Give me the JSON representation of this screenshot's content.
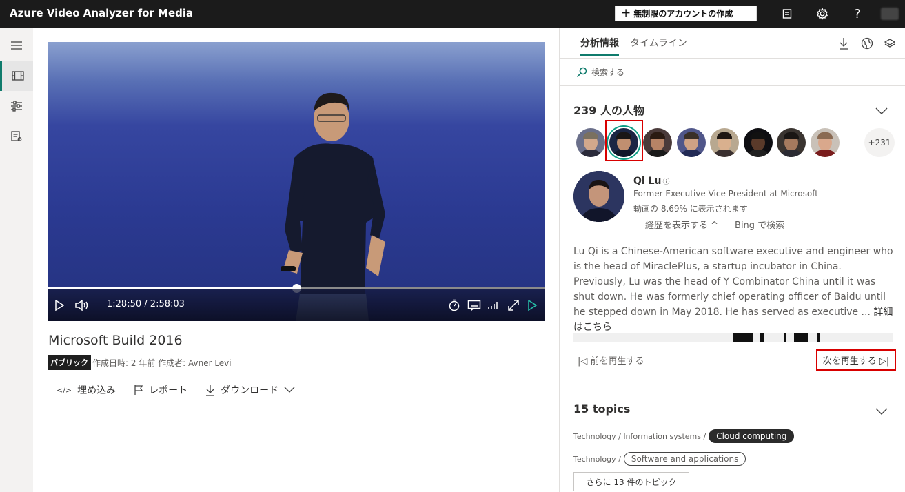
{
  "app": {
    "title": "Azure Video Analyzer for Media"
  },
  "header": {
    "create_account_label": "無制限のアカウントの作成",
    "icons": [
      "feedback-icon",
      "settings-icon",
      "help-icon",
      "user-avatar"
    ]
  },
  "left_nav": {
    "items": [
      "menu-icon",
      "media-library-icon",
      "customization-icon",
      "model-list-icon"
    ],
    "active": "media-library-icon"
  },
  "player": {
    "current_time": "1:28:50",
    "separator": "/",
    "duration": "2:58:03",
    "progress_fraction": 0.5
  },
  "video": {
    "title": "Microsoft Build 2016",
    "badge": "パブリック",
    "meta": "作成日時: 2 年前 作成者: Avner Levi",
    "actions": {
      "embed": "埋め込み",
      "report": "レポート",
      "download": "ダウンロード"
    }
  },
  "panel": {
    "tabs": [
      "分析情報",
      "タイムライン"
    ],
    "active_tab": "分析情報",
    "search_placeholder": "検索する"
  },
  "people": {
    "heading": "239 人の人物",
    "more_count": "+231",
    "selected_index": 1,
    "person": {
      "name": "Qi Lu",
      "info_symbol": "ⓘ",
      "role": "Former Executive Vice President at Microsoft",
      "appearance": "動画の 8.69% に表示されます",
      "show_bio": "経歴を表示する ^",
      "bing_search": "Bing で検索",
      "bio": "Lu Qi is a Chinese-American software executive and engineer who is the head of MiraclePlus, a startup incubator in China. Previously, Lu was the head of Y Combinator China until it was shut down. He was formerly chief operating officer of Baidu until he stepped down in May 2018. He has served as executive ...",
      "more_link": "詳細はこちら"
    },
    "prev_label": "|◁ 前を再生する",
    "next_label": "次を再生する ▷|",
    "appearance_segments": [
      {
        "start": 0.501,
        "end": 0.562
      },
      {
        "start": 0.583,
        "end": 0.596
      },
      {
        "start": 0.659,
        "end": 0.667
      },
      {
        "start": 0.691,
        "end": 0.734
      },
      {
        "start": 0.765,
        "end": 0.773
      }
    ]
  },
  "topics": {
    "heading": "15 topics",
    "rows": [
      {
        "path": "Technology / Information systems /",
        "label": "Cloud computing",
        "style": "dark"
      },
      {
        "path": "Technology /",
        "label": "Software and applications",
        "style": "outline"
      }
    ],
    "more_label": "さらに 13 件のトピック"
  },
  "colors": {
    "accent": "#0f7b6c",
    "highlight_frame": "#d80000",
    "topbar": "#1b1b1b"
  }
}
